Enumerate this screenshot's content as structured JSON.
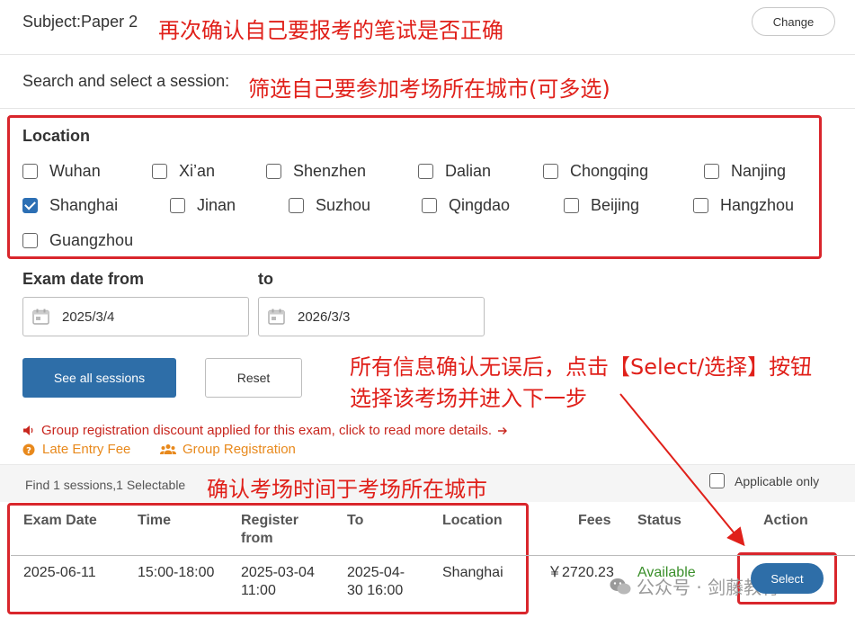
{
  "header": {
    "subject": "Subject:Paper 2",
    "change_label": "Change",
    "search_label": "Search and select a session:"
  },
  "annotations": {
    "note_subject": "再次确认自己要报考的笔试是否正确",
    "note_city": "筛选自己要参加考场所在城市(可多选)",
    "note_select_line1": "所有信息确认无误后，点击【Select/选择】按钮",
    "note_select_line2": "选择该考场并进入下一步",
    "note_time": "确认考场时间于考场所在城市"
  },
  "location": {
    "title": "Location",
    "options": [
      {
        "label": "Wuhan",
        "checked": false
      },
      {
        "label": "Xi’an",
        "checked": false
      },
      {
        "label": "Shenzhen",
        "checked": false
      },
      {
        "label": "Dalian",
        "checked": false
      },
      {
        "label": "Chongqing",
        "checked": false
      },
      {
        "label": "Nanjing",
        "checked": false
      },
      {
        "label": "Shanghai",
        "checked": true
      },
      {
        "label": "Jinan",
        "checked": false
      },
      {
        "label": "Suzhou",
        "checked": false
      },
      {
        "label": "Qingdao",
        "checked": false
      },
      {
        "label": "Beijing",
        "checked": false
      },
      {
        "label": "Hangzhou",
        "checked": false
      },
      {
        "label": "Guangzhou",
        "checked": false
      }
    ]
  },
  "dates": {
    "from_label": "Exam date from",
    "to_label": "to",
    "from_value": "2025/3/4",
    "to_value": "2026/3/3"
  },
  "buttons": {
    "see_all": "See all sessions",
    "reset": "Reset",
    "select": "Select"
  },
  "info": {
    "group_discount": "Group registration discount applied for this exam, click to read more details.",
    "late_entry": "Late Entry Fee",
    "group_registration": "Group Registration"
  },
  "results": {
    "count_text": "Find 1 sessions,1 Selectable",
    "applicable_only": "Applicable only",
    "applicable_checked": false,
    "columns": {
      "exam_date": "Exam Date",
      "time": "Time",
      "register_from_1": "Register",
      "register_from_2": "from",
      "to": "To",
      "location": "Location",
      "fees": "Fees",
      "status": "Status",
      "action": "Action"
    },
    "rows": [
      {
        "exam_date": "2025-06-11",
        "time": "15:00-18:00",
        "register_from_1": "2025-03-04",
        "register_from_2": "11:00",
        "to_1": "2025-04-",
        "to_2": "30 16:00",
        "location": "Shanghai",
        "fees": "￥2720.23",
        "status": "Available"
      }
    ]
  },
  "watermark": {
    "text": "公众号 · 剑藤教育"
  },
  "colors": {
    "annotation_red": "#e0201a",
    "primary_blue": "#2e6ea8",
    "status_green": "#3a8f2a",
    "info_orange": "#e8891c"
  }
}
